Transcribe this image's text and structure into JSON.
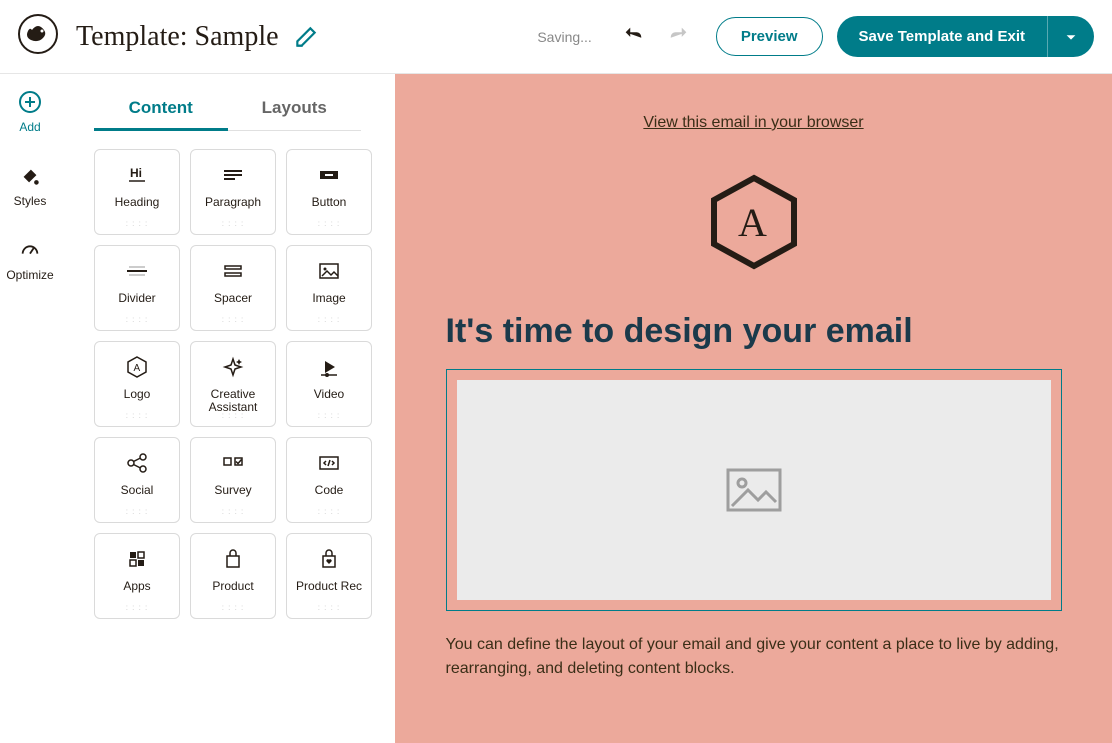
{
  "header": {
    "title": "Template: Sample",
    "saving": "Saving...",
    "preview": "Preview",
    "save": "Save Template and Exit"
  },
  "rail": {
    "add": "Add",
    "styles": "Styles",
    "optimize": "Optimize"
  },
  "tabs": {
    "content": "Content",
    "layouts": "Layouts"
  },
  "blocks": {
    "heading": "Heading",
    "paragraph": "Paragraph",
    "button": "Button",
    "divider": "Divider",
    "spacer": "Spacer",
    "image": "Image",
    "logo": "Logo",
    "creative": "Creative Assistant",
    "video": "Video",
    "social": "Social",
    "survey": "Survey",
    "code": "Code",
    "apps": "Apps",
    "product": "Product",
    "productrec": "Product Rec"
  },
  "canvas": {
    "view_link": "View this email in your browser",
    "headline": "It's time to design your email",
    "body": "You can define the layout of your email and give your content a place to live by adding, rearranging, and deleting content blocks."
  }
}
